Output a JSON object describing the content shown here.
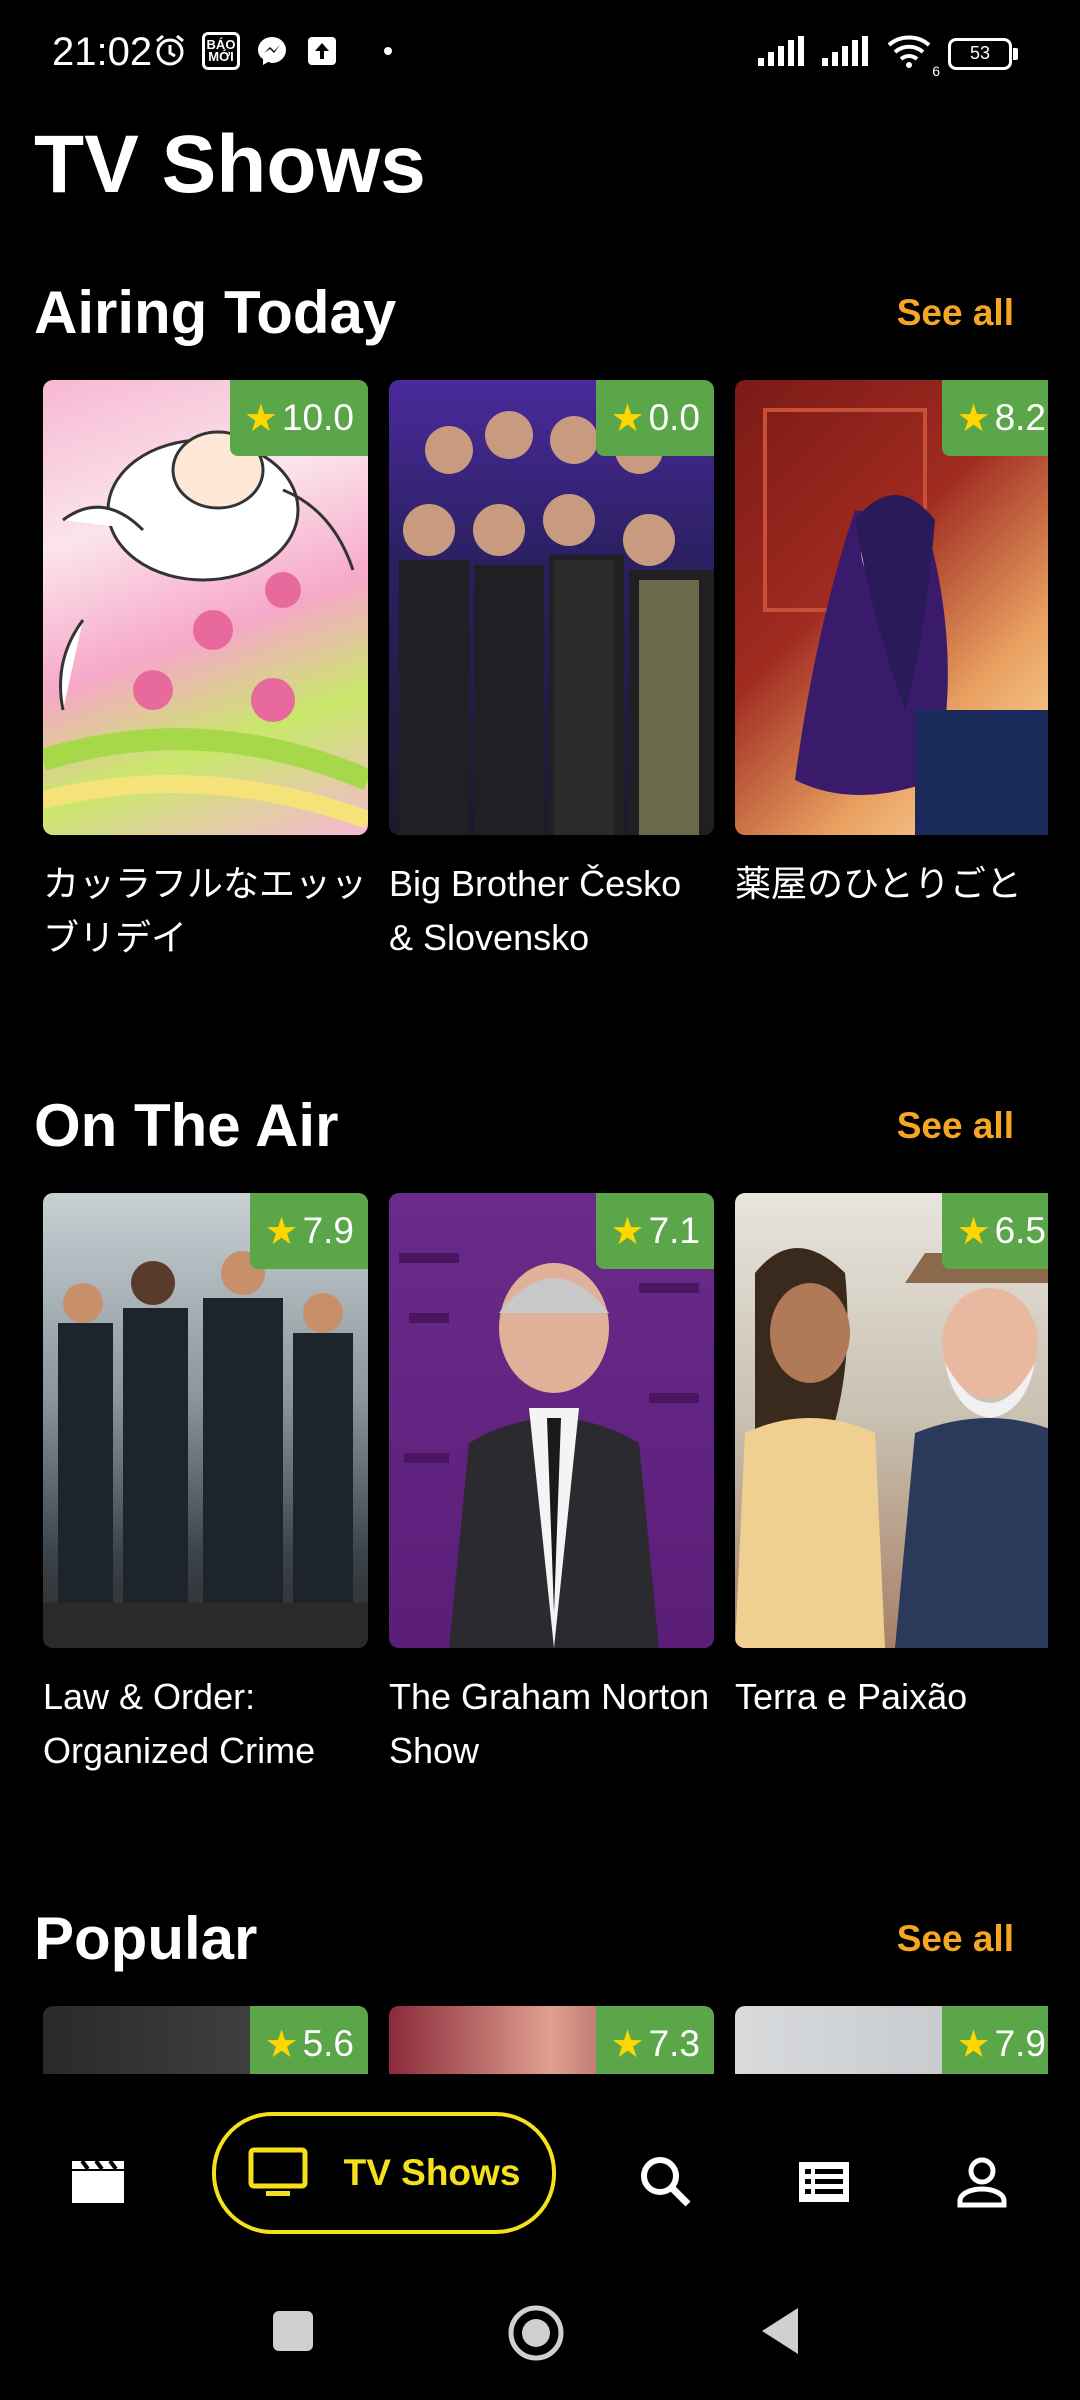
{
  "status_bar": {
    "time": "21:02",
    "notif_badge": "BÁO MỚI",
    "battery": "53",
    "wifi_sub": "6",
    "icons": [
      "alarm-icon",
      "bao-moi-icon",
      "messenger-icon",
      "upload-icon",
      "signal-icon",
      "signal-icon",
      "wifi-icon",
      "battery-icon"
    ]
  },
  "page": {
    "title": "TV Shows"
  },
  "sections": [
    {
      "title": "Airing Today",
      "see_all": "See all",
      "cards": [
        {
          "rating": "10.0",
          "title": "カッラフルなエッッブリデイ"
        },
        {
          "rating": "0.0",
          "title": "Big Brother Česko & Slovensko"
        },
        {
          "rating": "8.2",
          "title": "薬屋のひとりごと"
        }
      ]
    },
    {
      "title": "On The Air",
      "see_all": "See all",
      "cards": [
        {
          "rating": "7.9",
          "title": "Law & Order: Organized Crime"
        },
        {
          "rating": "7.1",
          "title": "The Graham Norton Show"
        },
        {
          "rating": "6.5",
          "title": "Terra e Paixão"
        }
      ]
    },
    {
      "title": "Popular",
      "see_all": "See all",
      "cards": [
        {
          "rating": "5.6",
          "title": ""
        },
        {
          "rating": "7.3",
          "title": ""
        },
        {
          "rating": "7.9",
          "title": ""
        }
      ]
    }
  ],
  "bottom_nav": {
    "active_label": "TV Shows",
    "items": [
      "movies-icon",
      "tv-icon",
      "search-icon",
      "list-icon",
      "profile-icon"
    ]
  },
  "colors": {
    "accent": "#f5a623",
    "nav_active": "#f5e01c",
    "rating_bg": "#5aa648",
    "star": "#ffd600",
    "background": "#000000"
  }
}
